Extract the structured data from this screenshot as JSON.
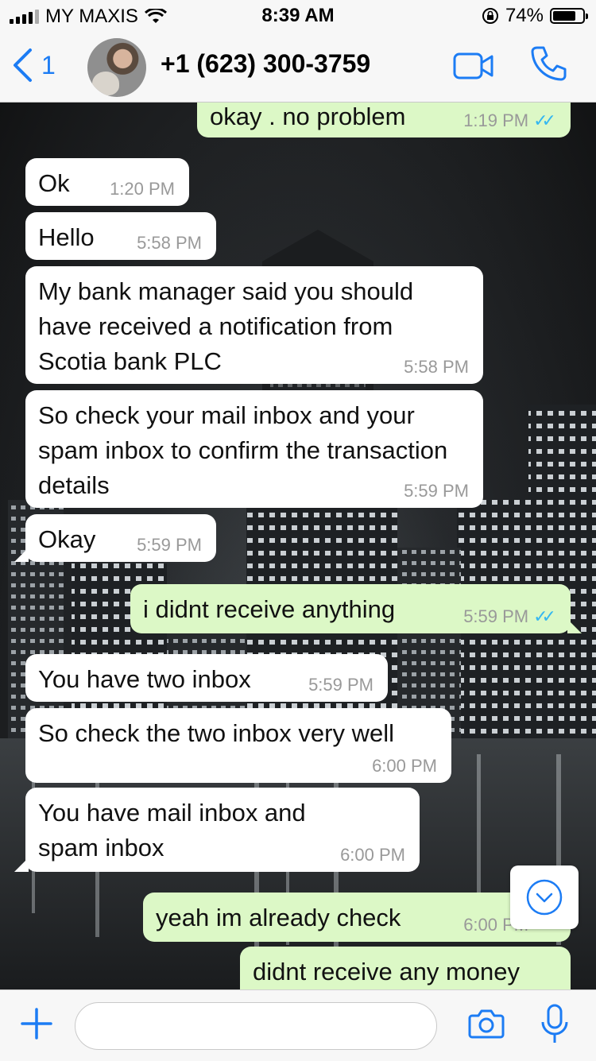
{
  "status_bar": {
    "carrier": "MY MAXIS",
    "time": "8:39 AM",
    "battery": "74%",
    "battery_level": 0.74
  },
  "header": {
    "back_count": "1",
    "contact": "+1 (623) 300-3759",
    "icons": [
      "back-chevron-icon",
      "video-call-icon",
      "phone-icon"
    ]
  },
  "messages": [
    {
      "dir": "out",
      "text": "okay . no problem",
      "time": "1:19 PM",
      "read": true
    },
    {
      "dir": "in",
      "text": "Ok",
      "time": "1:20 PM"
    },
    {
      "dir": "in",
      "text": "Hello",
      "time": "5:58 PM"
    },
    {
      "dir": "in",
      "text": "My bank manager said you should have received a notification from Scotia bank PLC",
      "time": "5:58 PM"
    },
    {
      "dir": "in",
      "text": "So check your mail inbox and your spam inbox to confirm the transaction details",
      "time": "5:59 PM"
    },
    {
      "dir": "in",
      "text": "Okay",
      "time": "5:59 PM"
    },
    {
      "dir": "out",
      "text": "i didnt receive anything",
      "time": "5:59 PM",
      "read": true
    },
    {
      "dir": "in",
      "text": "You have two inbox",
      "time": "5:59 PM"
    },
    {
      "dir": "in",
      "text": "So check the two inbox very well",
      "time": "6:00 PM"
    },
    {
      "dir": "in",
      "text": "You have mail inbox and spam inbox",
      "time": "6:00 PM"
    },
    {
      "dir": "out",
      "text": "yeah im already check",
      "time": "6:00 PM",
      "read": true
    },
    {
      "dir": "out",
      "text": "didnt receive any money",
      "time": ""
    }
  ],
  "input": {
    "placeholder": ""
  },
  "colors": {
    "accent": "#1c7cf4",
    "outgoing_bubble": "#dcf8c6",
    "incoming_bubble": "#ffffff",
    "read_ticks": "#34b7f1"
  }
}
